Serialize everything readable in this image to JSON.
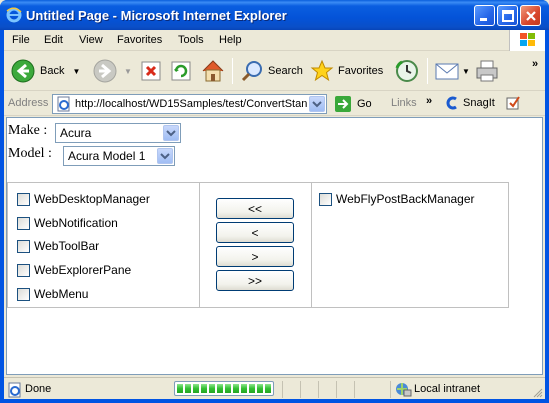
{
  "window": {
    "title": "Untitled Page - Microsoft Internet Explorer"
  },
  "menubar": {
    "items": [
      {
        "label": "File",
        "access": "F"
      },
      {
        "label": "Edit",
        "access": "E"
      },
      {
        "label": "View",
        "access": "V"
      },
      {
        "label": "Favorites",
        "access": "a"
      },
      {
        "label": "Tools",
        "access": "T"
      },
      {
        "label": "Help",
        "access": "H"
      }
    ]
  },
  "toolbar": {
    "back_label": "Back",
    "search_label": "Search",
    "favorites_label": "Favorites"
  },
  "addressbar": {
    "label": "Address",
    "url": "http://localhost/WD15Samples/test/ConvertStan",
    "go_label": "Go",
    "links_label": "Links",
    "snagit_label": "SnagIt"
  },
  "form": {
    "make_label": "Make :",
    "make_value": "Acura",
    "model_label": "Model :",
    "model_value": "Acura Model 1"
  },
  "left_list": [
    "WebDesktopManager",
    "WebNotification",
    "WebToolBar",
    "WebExplorerPane",
    "WebMenu"
  ],
  "right_list": [
    "WebFlyPostBackManager"
  ],
  "move_buttons": {
    "move_all_left": "<<",
    "move_left": "<",
    "move_right": ">",
    "move_all_right": ">>"
  },
  "statusbar": {
    "status_text": "Done",
    "zone_text": "Local intranet",
    "progress_fraction": 1.0
  },
  "colors": {
    "titlebar": "#0054e3",
    "chrome": "#ece9d8",
    "progress": "#32c032"
  }
}
